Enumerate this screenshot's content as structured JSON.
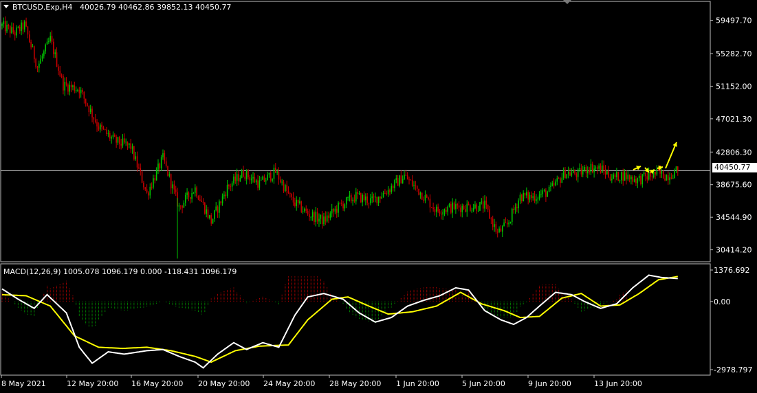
{
  "header": {
    "symbol": "BTCUSD.Exp,H4",
    "ohlc": "40026.79 40462.86 39852.13 40450.77"
  },
  "current_price": "40450.77",
  "macd": {
    "label": "MACD(12,26,9) 1005.078 1096.179 0.000 -118.431 1096.179",
    "axis": [
      "1376.692",
      "0.00",
      "-2978.797"
    ]
  },
  "price_axis": [
    "59497.70",
    "55282.70",
    "51152.00",
    "47021.30",
    "42806.30",
    "38675.60",
    "34544.90",
    "30414.20"
  ],
  "time_axis": [
    "8 May 2021",
    "12 May 20:00",
    "16 May 20:00",
    "20 May 20:00",
    "24 May 20:00",
    "28 May 20:00",
    "1 Jun 20:00",
    "5 Jun 20:00",
    "9 Jun 20:00",
    "13 Jun 20:00"
  ],
  "colors": {
    "background": "#000000",
    "bull": "#00c800",
    "bear": "#c80000",
    "macd_line": "#ffffff",
    "signal_line": "#ffff00",
    "hist_up": "#c80000",
    "hist_down": "#00a000",
    "forecast_arrows": "#ffff00",
    "grid_line": "#c0c0c0"
  },
  "chart_data": [
    {
      "type": "candlestick",
      "title": "BTCUSD.Exp,H4",
      "ylim": [
        28900,
        61900
      ],
      "x_ticks": [
        "8 May 2021",
        "12 May 20:00",
        "16 May 20:00",
        "20 May 20:00",
        "24 May 20:00",
        "28 May 20:00",
        "1 Jun 20:00",
        "5 Jun 20:00",
        "9 Jun 20:00",
        "13 Jun 20:00"
      ],
      "y_ticks": [
        59497.7,
        55282.7,
        51152.0,
        47021.3,
        42806.3,
        38675.6,
        34544.9,
        30414.2
      ],
      "last_price": 40450.77,
      "close_path": [
        [
          0,
          58800
        ],
        [
          8,
          57900
        ],
        [
          14,
          58900
        ],
        [
          22,
          53600
        ],
        [
          30,
          57100
        ],
        [
          38,
          51300
        ],
        [
          48,
          50800
        ],
        [
          60,
          46000
        ],
        [
          70,
          44200
        ],
        [
          80,
          43500
        ],
        [
          90,
          37500
        ],
        [
          100,
          42000
        ],
        [
          110,
          35800
        ],
        [
          120,
          38200
        ],
        [
          130,
          34000
        ],
        [
          140,
          38300
        ],
        [
          150,
          40200
        ],
        [
          160,
          38800
        ],
        [
          170,
          40300
        ],
        [
          180,
          36700
        ],
        [
          190,
          35000
        ],
        [
          200,
          34100
        ],
        [
          210,
          36000
        ],
        [
          220,
          37200
        ],
        [
          230,
          36600
        ],
        [
          240,
          38000
        ],
        [
          250,
          39800
        ],
        [
          260,
          37700
        ],
        [
          270,
          35400
        ],
        [
          280,
          35800
        ],
        [
          290,
          35900
        ],
        [
          300,
          36000
        ],
        [
          308,
          32500
        ],
        [
          314,
          33600
        ],
        [
          322,
          37200
        ],
        [
          330,
          37100
        ],
        [
          340,
          37800
        ],
        [
          350,
          40200
        ],
        [
          358,
          40000
        ],
        [
          365,
          40900
        ],
        [
          373,
          40600
        ],
        [
          380,
          39500
        ],
        [
          385,
          39900
        ],
        [
          395,
          39300
        ],
        [
          400,
          39600
        ],
        [
          407,
          40100
        ],
        [
          413,
          39800
        ],
        [
          420,
          40450.77
        ]
      ],
      "num_candles": 421
    },
    {
      "type": "line",
      "title": "MACD(12,26,9)",
      "values": {
        "main": 1005.078,
        "signal": 1096.179,
        "third": 0.0,
        "fourth": -118.431,
        "fifth": 1096.179
      },
      "ylim": [
        -2978.797,
        1376.692
      ],
      "series": [
        {
          "name": "main",
          "points": [
            [
              0,
              550
            ],
            [
              10,
              100
            ],
            [
              20,
              -300
            ],
            [
              28,
              300
            ],
            [
              40,
              -500
            ],
            [
              48,
              -2000
            ],
            [
              56,
              -2700
            ],
            [
              66,
              -2200
            ],
            [
              76,
              -2300
            ],
            [
              90,
              -2150
            ],
            [
              100,
              -2100
            ],
            [
              110,
              -2400
            ],
            [
              120,
              -2650
            ],
            [
              125,
              -2900
            ],
            [
              134,
              -2300
            ],
            [
              144,
              -1800
            ],
            [
              152,
              -2100
            ],
            [
              162,
              -1800
            ],
            [
              172,
              -2000
            ],
            [
              182,
              -600
            ],
            [
              190,
              200
            ],
            [
              200,
              350
            ],
            [
              212,
              100
            ],
            [
              222,
              -500
            ],
            [
              232,
              -900
            ],
            [
              242,
              -700
            ],
            [
              252,
              -200
            ],
            [
              262,
              50
            ],
            [
              272,
              250
            ],
            [
              282,
              600
            ],
            [
              290,
              500
            ],
            [
              300,
              -400
            ],
            [
              310,
              -800
            ],
            [
              318,
              -1000
            ],
            [
              326,
              -700
            ],
            [
              334,
              -200
            ],
            [
              344,
              400
            ],
            [
              354,
              300
            ],
            [
              362,
              0
            ],
            [
              372,
              -300
            ],
            [
              382,
              -100
            ],
            [
              392,
              600
            ],
            [
              402,
              1150
            ],
            [
              410,
              1050
            ],
            [
              420,
              1005
            ]
          ]
        },
        {
          "name": "signal",
          "points": [
            [
              0,
              300
            ],
            [
              15,
              250
            ],
            [
              30,
              -200
            ],
            [
              45,
              -1500
            ],
            [
              60,
              -2000
            ],
            [
              75,
              -2050
            ],
            [
              90,
              -2000
            ],
            [
              105,
              -2150
            ],
            [
              120,
              -2400
            ],
            [
              130,
              -2650
            ],
            [
              145,
              -2150
            ],
            [
              160,
              -1950
            ],
            [
              178,
              -1900
            ],
            [
              190,
              -800
            ],
            [
              205,
              100
            ],
            [
              215,
              200
            ],
            [
              228,
              -200
            ],
            [
              240,
              -550
            ],
            [
              255,
              -450
            ],
            [
              270,
              -200
            ],
            [
              285,
              400
            ],
            [
              298,
              -100
            ],
            [
              312,
              -400
            ],
            [
              322,
              -700
            ],
            [
              334,
              -650
            ],
            [
              348,
              150
            ],
            [
              360,
              350
            ],
            [
              372,
              -200
            ],
            [
              384,
              -150
            ],
            [
              396,
              350
            ],
            [
              408,
              950
            ],
            [
              420,
              1096
            ]
          ]
        }
      ]
    }
  ]
}
